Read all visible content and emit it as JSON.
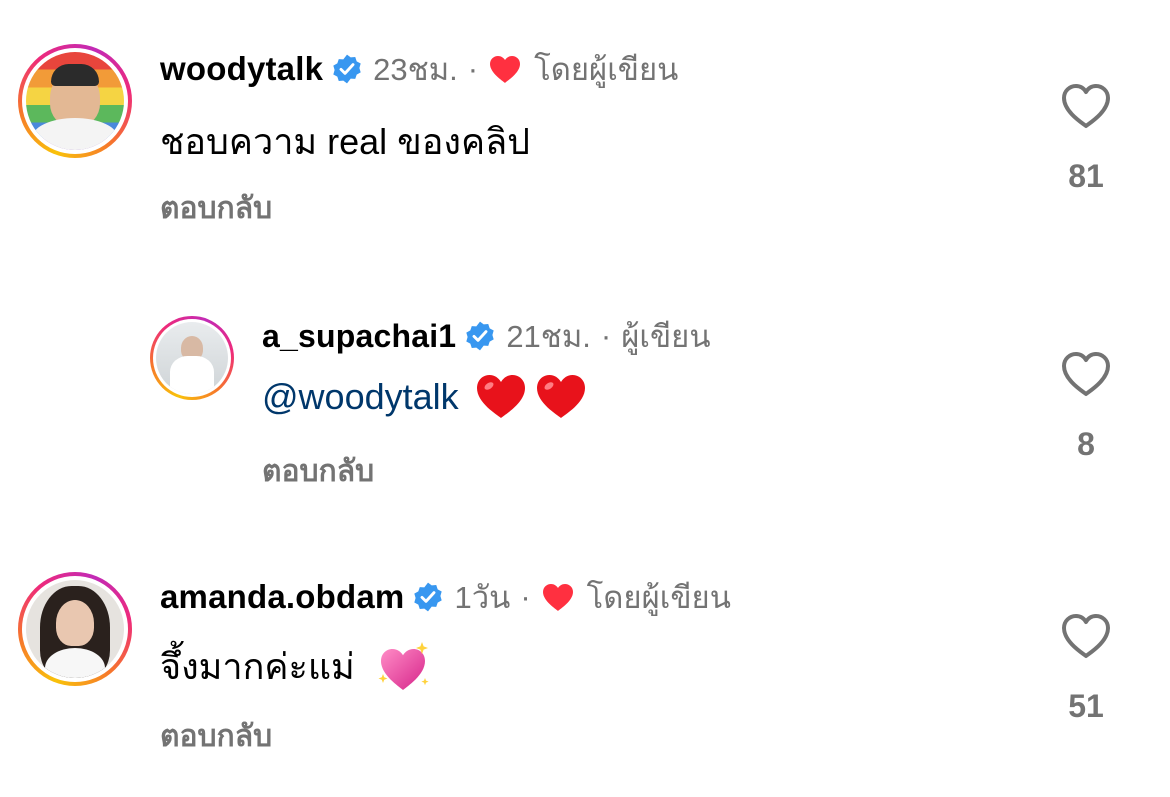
{
  "comments": [
    {
      "username": "woodytalk",
      "verified": true,
      "time": "23ชม.",
      "separator": "·",
      "liked_by_author": true,
      "author_label": "โดยผู้เขียน",
      "text": "ชอบความ real ของคลิป",
      "reply_label": "ตอบกลับ",
      "likes": "81",
      "avatar_icon": "avatar-rainbow-icon"
    },
    {
      "username": "a_supachai1",
      "verified": true,
      "time": "21ชม.",
      "separator": "·",
      "author_label": "ผู้เขียน",
      "mention": "@woodytalk",
      "reply_label": "ตอบกลับ",
      "likes": "8",
      "emoji": [
        "red-heart-icon",
        "red-heart-icon"
      ]
    },
    {
      "username": "amanda.obdam",
      "verified": true,
      "time": "1วัน",
      "separator": "·",
      "liked_by_author": true,
      "author_label": "โดยผู้เขียน",
      "text": "จึ้งมากค่ะแม่",
      "reply_label": "ตอบกลับ",
      "likes": "51",
      "emoji": [
        "sparkling-heart-icon"
      ]
    }
  ],
  "colors": {
    "verified_blue": "#3897f0",
    "heart_red": "#ff3040",
    "secondary_text": "#737373",
    "mention_blue": "#00376b"
  }
}
